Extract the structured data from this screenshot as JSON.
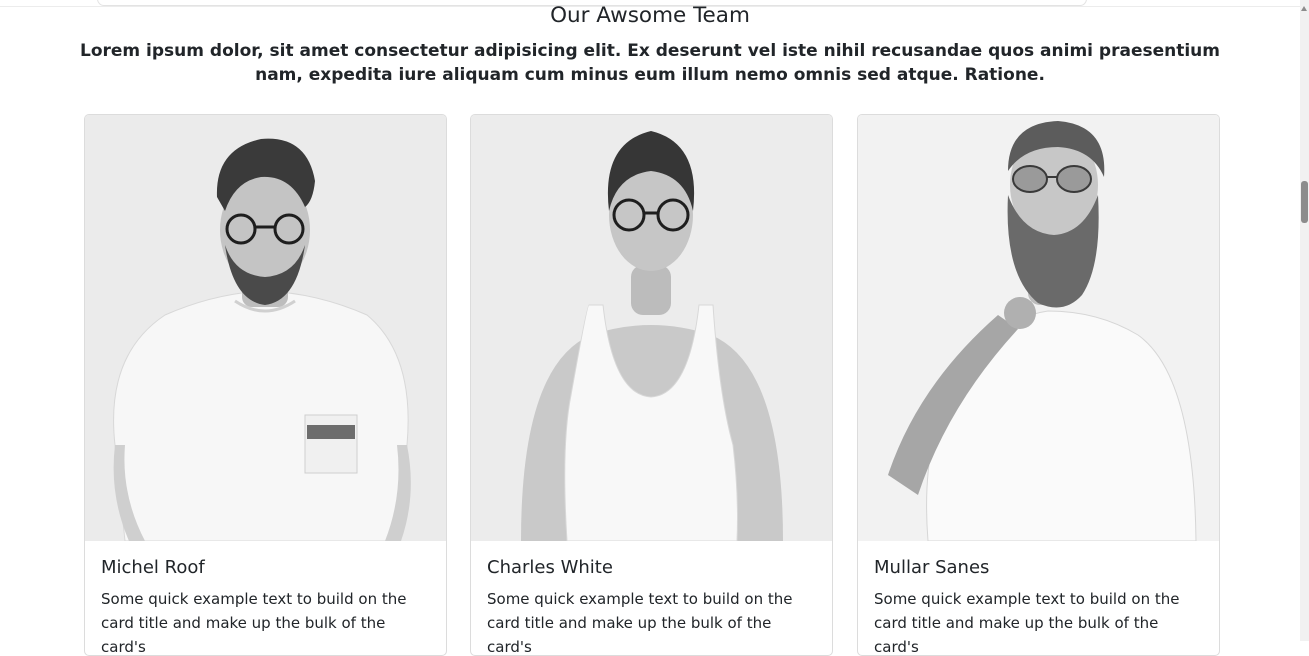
{
  "section": {
    "title": "Our Awsome Team",
    "subtitle": "Lorem ipsum dolor, sit amet consectetur adipisicing elit. Ex deserunt vel iste nihil recusandae quos animi praesentium nam, expedita iure aliquam cum minus eum illum nemo omnis sed atque. Ratione."
  },
  "team": [
    {
      "name": "Michel Roof",
      "text": "Some quick example text to build on the card title and make up the bulk of the card's",
      "photo": "man-glasses-tshirt-portrait"
    },
    {
      "name": "Charles White",
      "text": "Some quick example text to build on the card title and make up the bulk of the card's",
      "photo": "woman-glasses-tanktop-portrait"
    },
    {
      "name": "Mullar Sanes",
      "text": "Some quick example text to build on the card title and make up the bulk of the card's",
      "photo": "bearded-man-sunglasses-portrait"
    }
  ],
  "colors": {
    "text": "#212529",
    "card_border": "#dcdcdc",
    "photo_bg": "#ececec"
  }
}
